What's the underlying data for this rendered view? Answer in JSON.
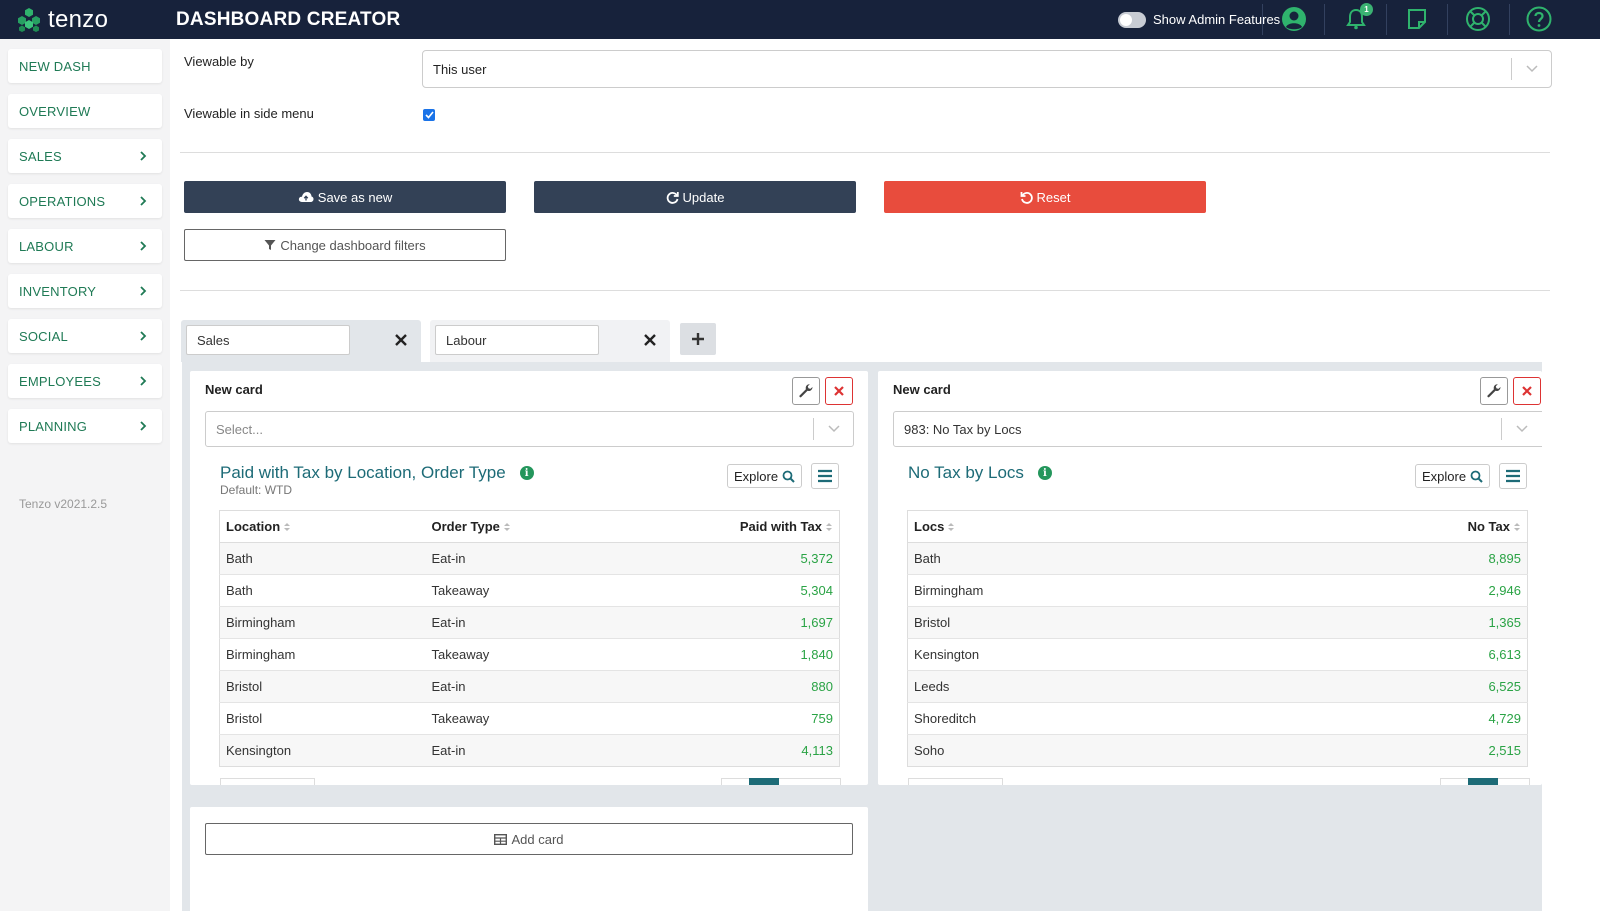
{
  "app": {
    "brand": "tenzo",
    "title": "DASHBOARD CREATOR"
  },
  "header": {
    "admin_label": "Show Admin Features",
    "admin_enabled": false,
    "notification_count": "1"
  },
  "sidebar": {
    "items": [
      {
        "label": "NEW DASH"
      },
      {
        "label": "OVERVIEW"
      },
      {
        "label": "SALES"
      },
      {
        "label": "OPERATIONS"
      },
      {
        "label": "LABOUR"
      },
      {
        "label": "INVENTORY"
      },
      {
        "label": "SOCIAL"
      },
      {
        "label": "EMPLOYEES"
      },
      {
        "label": "PLANNING"
      }
    ],
    "version": "Tenzo v2021.2.5"
  },
  "form": {
    "viewable_by_label": "Viewable by",
    "viewable_by_value": "This user",
    "side_menu_label": "Viewable in side menu",
    "side_menu_checked": true
  },
  "actions": {
    "save_as_new": "Save as new",
    "update": "Update",
    "reset": "Reset",
    "change_filters": "Change dashboard filters"
  },
  "tabs": [
    {
      "name": "Sales",
      "active": true
    },
    {
      "name": "Labour",
      "active": false
    }
  ],
  "cards": [
    {
      "title": "New card",
      "select_value": "",
      "select_placeholder": "Select...",
      "report_title": "Paid with Tax by Location, Order Type",
      "report_subtitle": "Default: WTD",
      "explore_label": "Explore",
      "columns": [
        "Location",
        "Order Type",
        "Paid with Tax"
      ],
      "rows": [
        [
          "Bath",
          "Eat-in",
          "5,372"
        ],
        [
          "Bath",
          "Takeaway",
          "5,304"
        ],
        [
          "Birmingham",
          "Eat-in",
          "1,697"
        ],
        [
          "Birmingham",
          "Takeaway",
          "1,840"
        ],
        [
          "Bristol",
          "Eat-in",
          "880"
        ],
        [
          "Bristol",
          "Takeaway",
          "759"
        ],
        [
          "Kensington",
          "Eat-in",
          "4,113"
        ]
      ]
    },
    {
      "title": "New card",
      "select_value": "983: No Tax by Locs",
      "report_title": "No Tax by Locs",
      "explore_label": "Explore",
      "columns": [
        "Locs",
        "No Tax"
      ],
      "rows": [
        [
          "Bath",
          "8,895"
        ],
        [
          "Birmingham",
          "2,946"
        ],
        [
          "Bristol",
          "1,365"
        ],
        [
          "Kensington",
          "6,613"
        ],
        [
          "Leeds",
          "6,525"
        ],
        [
          "Shoreditch",
          "4,729"
        ],
        [
          "Soho",
          "2,515"
        ]
      ]
    }
  ],
  "add_card_label": "Add card",
  "colors": {
    "nav": "#17223b",
    "accent": "#1f7a55",
    "danger": "#e84c3d",
    "button_dark": "#334156",
    "value_green": "#2aa345"
  }
}
